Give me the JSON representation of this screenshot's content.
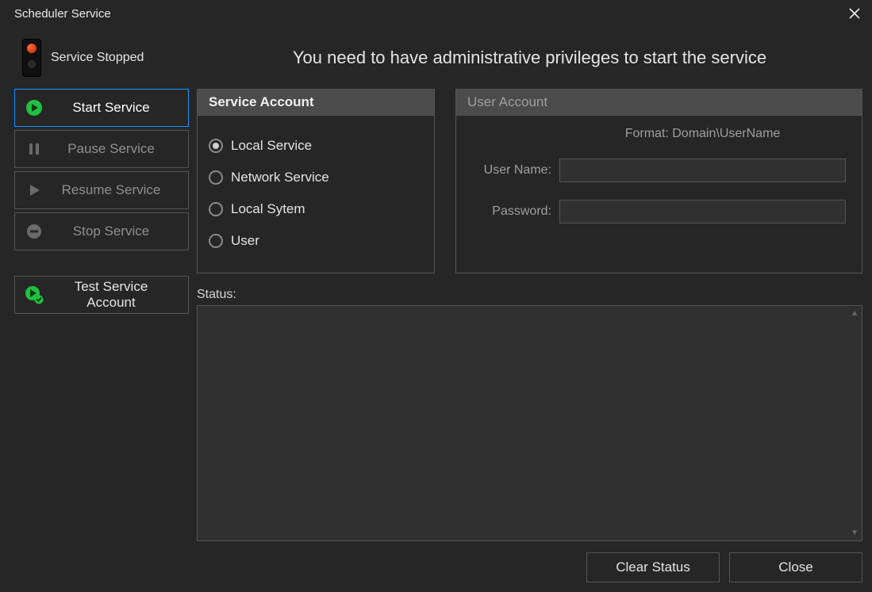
{
  "window": {
    "title": "Scheduler Service"
  },
  "service_state": {
    "label": "Service  Stopped"
  },
  "sidebar": {
    "start": {
      "label": "Start Service"
    },
    "pause": {
      "label": "Pause Service"
    },
    "resume": {
      "label": "Resume Service"
    },
    "stop": {
      "label": "Stop Service"
    },
    "test": {
      "label": "Test Service Account"
    }
  },
  "notice": "You need to have administrative privileges to start the service",
  "service_account": {
    "header": "Service Account",
    "options": {
      "local_service": "Local Service",
      "network_service": "Network Service",
      "local_system": "Local Sytem",
      "user": "User"
    },
    "selected": "local_service"
  },
  "user_account": {
    "header": "User Account",
    "format_hint": "Format: Domain\\UserName",
    "username_label": "User Name:",
    "password_label": "Password:",
    "username_value": "",
    "password_value": ""
  },
  "status": {
    "label": "Status:",
    "text": ""
  },
  "buttons": {
    "clear_status": "Clear Status",
    "close": "Close"
  },
  "colors": {
    "accent_green": "#20c040",
    "background": "#262626",
    "panel_header": "#4b4b4b",
    "border": "#555555",
    "selection_border": "#1e90ff"
  }
}
